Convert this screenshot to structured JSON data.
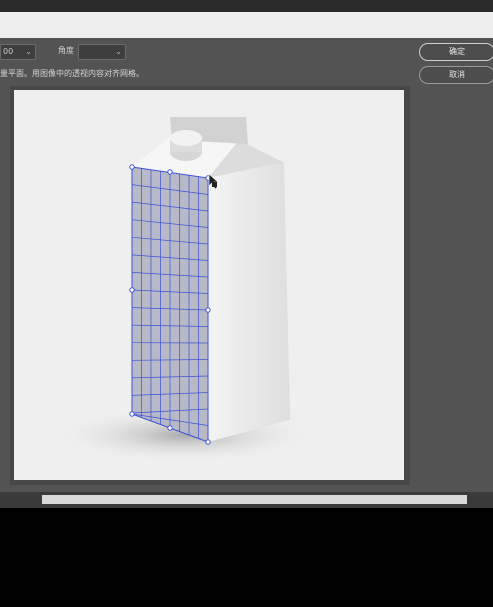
{
  "toolbar": {
    "size_value": "00",
    "angle_label": "角度",
    "angle_value": ""
  },
  "hint_text": "量平面。用图像中的透视内容对齐网格。",
  "buttons": {
    "ok_label": "确定",
    "cancel_label": "取消"
  },
  "colors": {
    "dialog_bg": "#535353",
    "canvas_bg": "#efefef",
    "grid_color": "#3d52d8",
    "grid_fill": "#b7b9c6"
  },
  "icons": {
    "cursor": "perspective-cursor-icon"
  }
}
